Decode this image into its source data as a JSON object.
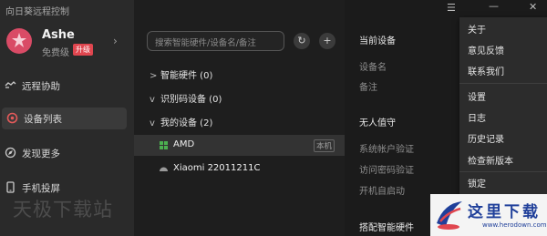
{
  "app": {
    "title": "向日葵远程控制"
  },
  "profile": {
    "username": "Ashe",
    "tier": "免费级",
    "upgrade": "升级"
  },
  "nav": [
    {
      "label": "远程协助",
      "icon": "remote-assist-icon"
    },
    {
      "label": "设备列表",
      "icon": "device-list-icon",
      "active": true
    },
    {
      "label": "发现更多",
      "icon": "discover-icon"
    },
    {
      "label": "手机投屏",
      "icon": "phone-cast-icon"
    }
  ],
  "search": {
    "placeholder": "搜索智能硬件/设备名/备注"
  },
  "groups": [
    {
      "label": "智能硬件 (0)",
      "caret": ">"
    },
    {
      "label": "识别码设备 (0)",
      "caret": "v"
    },
    {
      "label": "我的设备 (2)",
      "caret": "v"
    }
  ],
  "devices": [
    {
      "name": "AMD",
      "badge": "本机",
      "os": "windows"
    },
    {
      "name": "Xiaomi 22011211C",
      "os": "android"
    }
  ],
  "right_panel": {
    "current_device_heading": "当前设备",
    "device_name_label": "设备名",
    "remark_label": "备注",
    "unattended_heading": "无人值守",
    "system_account_verify": "系统帐户验证",
    "access_password_verify": "访问密码验证",
    "boot_autostart": "开机自启动",
    "smart_hardware_heading": "搭配智能硬件"
  },
  "menu": {
    "items": [
      "关于",
      "意见反馈",
      "联系我们",
      "设置",
      "日志",
      "历史记录",
      "检查新版本",
      "锁定"
    ]
  },
  "watermarks": {
    "left": "天极下载站",
    "right": "这里下载",
    "right_url": "www.herodown.com"
  },
  "colors": {
    "accent": "#e0464f",
    "avatar": "#d94b66",
    "windows_green": "#4caf50"
  }
}
